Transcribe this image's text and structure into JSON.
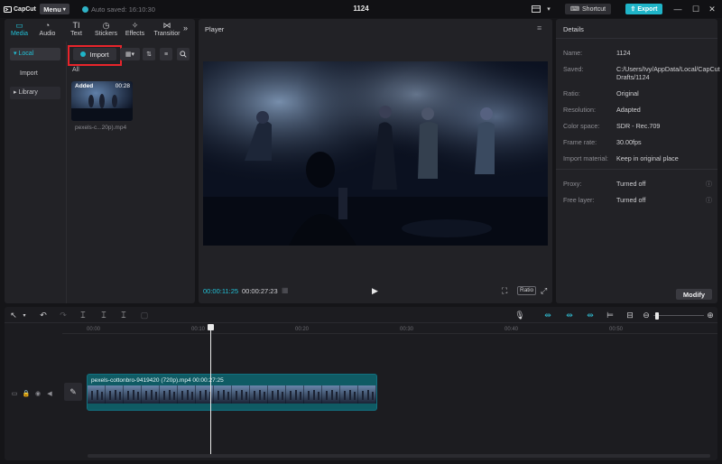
{
  "app": {
    "logo_text": "CapCut",
    "menu_label": "Menu",
    "autosave_text": "Auto saved: 16:10:30",
    "project_title": "1124",
    "shortcut_label": "Shortcut",
    "export_label": "Export"
  },
  "media_panel": {
    "tabs": [
      {
        "label": "Media",
        "icon": "media-icon",
        "active": true
      },
      {
        "label": "Audio",
        "icon": "audio-icon",
        "active": false
      },
      {
        "label": "Text",
        "icon": "text-icon",
        "active": false
      },
      {
        "label": "Stickers",
        "icon": "stickers-icon",
        "active": false
      },
      {
        "label": "Effects",
        "icon": "effects-icon",
        "active": false
      },
      {
        "label": "Transitior",
        "icon": "transition-icon",
        "active": false
      }
    ],
    "sidebar": [
      {
        "label": "Local",
        "active": true
      },
      {
        "label": "Import",
        "active": false
      },
      {
        "label": "Library",
        "active": false
      }
    ],
    "import_label": "Import",
    "filter_label": "All",
    "media_item": {
      "badge": "Added",
      "duration": "00:28",
      "filename": "pexels-c...20p).mp4"
    }
  },
  "player": {
    "title": "Player",
    "current_time": "00:00:11:25",
    "total_time": "00:00:27:23",
    "ratio_label": "Ratio"
  },
  "details": {
    "title": "Details",
    "rows": [
      {
        "label": "Name:",
        "value": "1124"
      },
      {
        "label": "Saved:",
        "value": "C:/Users/Ivy/AppData/Local/CapCut Drafts/1124"
      },
      {
        "label": "Ratio:",
        "value": "Original"
      },
      {
        "label": "Resolution:",
        "value": "Adapted"
      },
      {
        "label": "Color space:",
        "value": "SDR - Rec.709"
      },
      {
        "label": "Frame rate:",
        "value": "30.00fps"
      },
      {
        "label": "Import material:",
        "value": "Keep in original place"
      },
      {
        "label": "Proxy:",
        "value": "Turned off"
      },
      {
        "label": "Free layer:",
        "value": "Turned off"
      }
    ],
    "modify_label": "Modify"
  },
  "timeline": {
    "ruler": [
      "00:00",
      "00:10",
      "00:20",
      "00:30",
      "00:40",
      "00:50"
    ],
    "clip_label": "pexels-cottonbro-9419420 (720p).mp4  00:00:27:25"
  }
}
